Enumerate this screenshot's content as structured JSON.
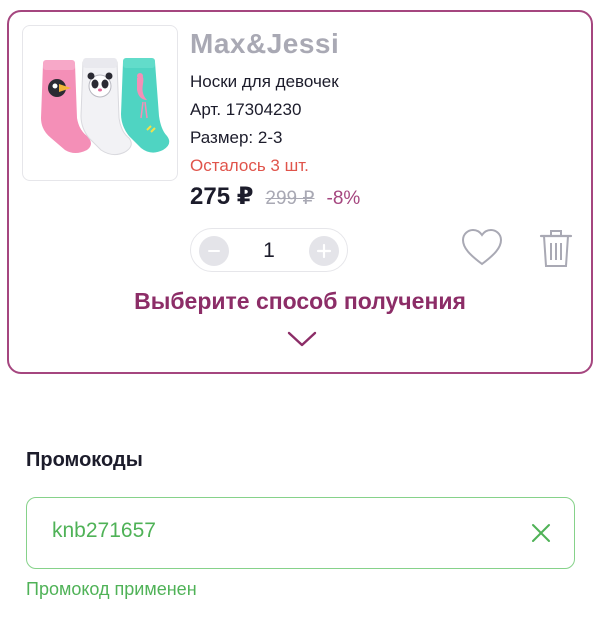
{
  "cart_item": {
    "brand": "Max&Jessi",
    "name": "Носки для девочек",
    "article": "Арт. 17304230",
    "size": "Размер: 2-3",
    "stock": "Осталось 3 шт.",
    "price": "275 ₽",
    "old_price": "299 ₽",
    "discount": "-8%",
    "quantity": "1",
    "image_icon": "socks-image",
    "icons": {
      "decrease": "minus-icon",
      "increase": "plus-icon",
      "favorite": "heart-icon",
      "delete": "trash-icon",
      "expand": "chevron-down-icon"
    },
    "delivery_prompt": "Выберите способ получения"
  },
  "promo": {
    "title": "Промокоды",
    "value": "knb271657",
    "status": "Промокод применен",
    "clear_icon": "close-icon"
  },
  "colors": {
    "accent": "#a5467f",
    "accent_text": "#8c2d67",
    "success": "#4fb257",
    "success_border": "#86d28a",
    "stock_warning": "#e0544b"
  }
}
